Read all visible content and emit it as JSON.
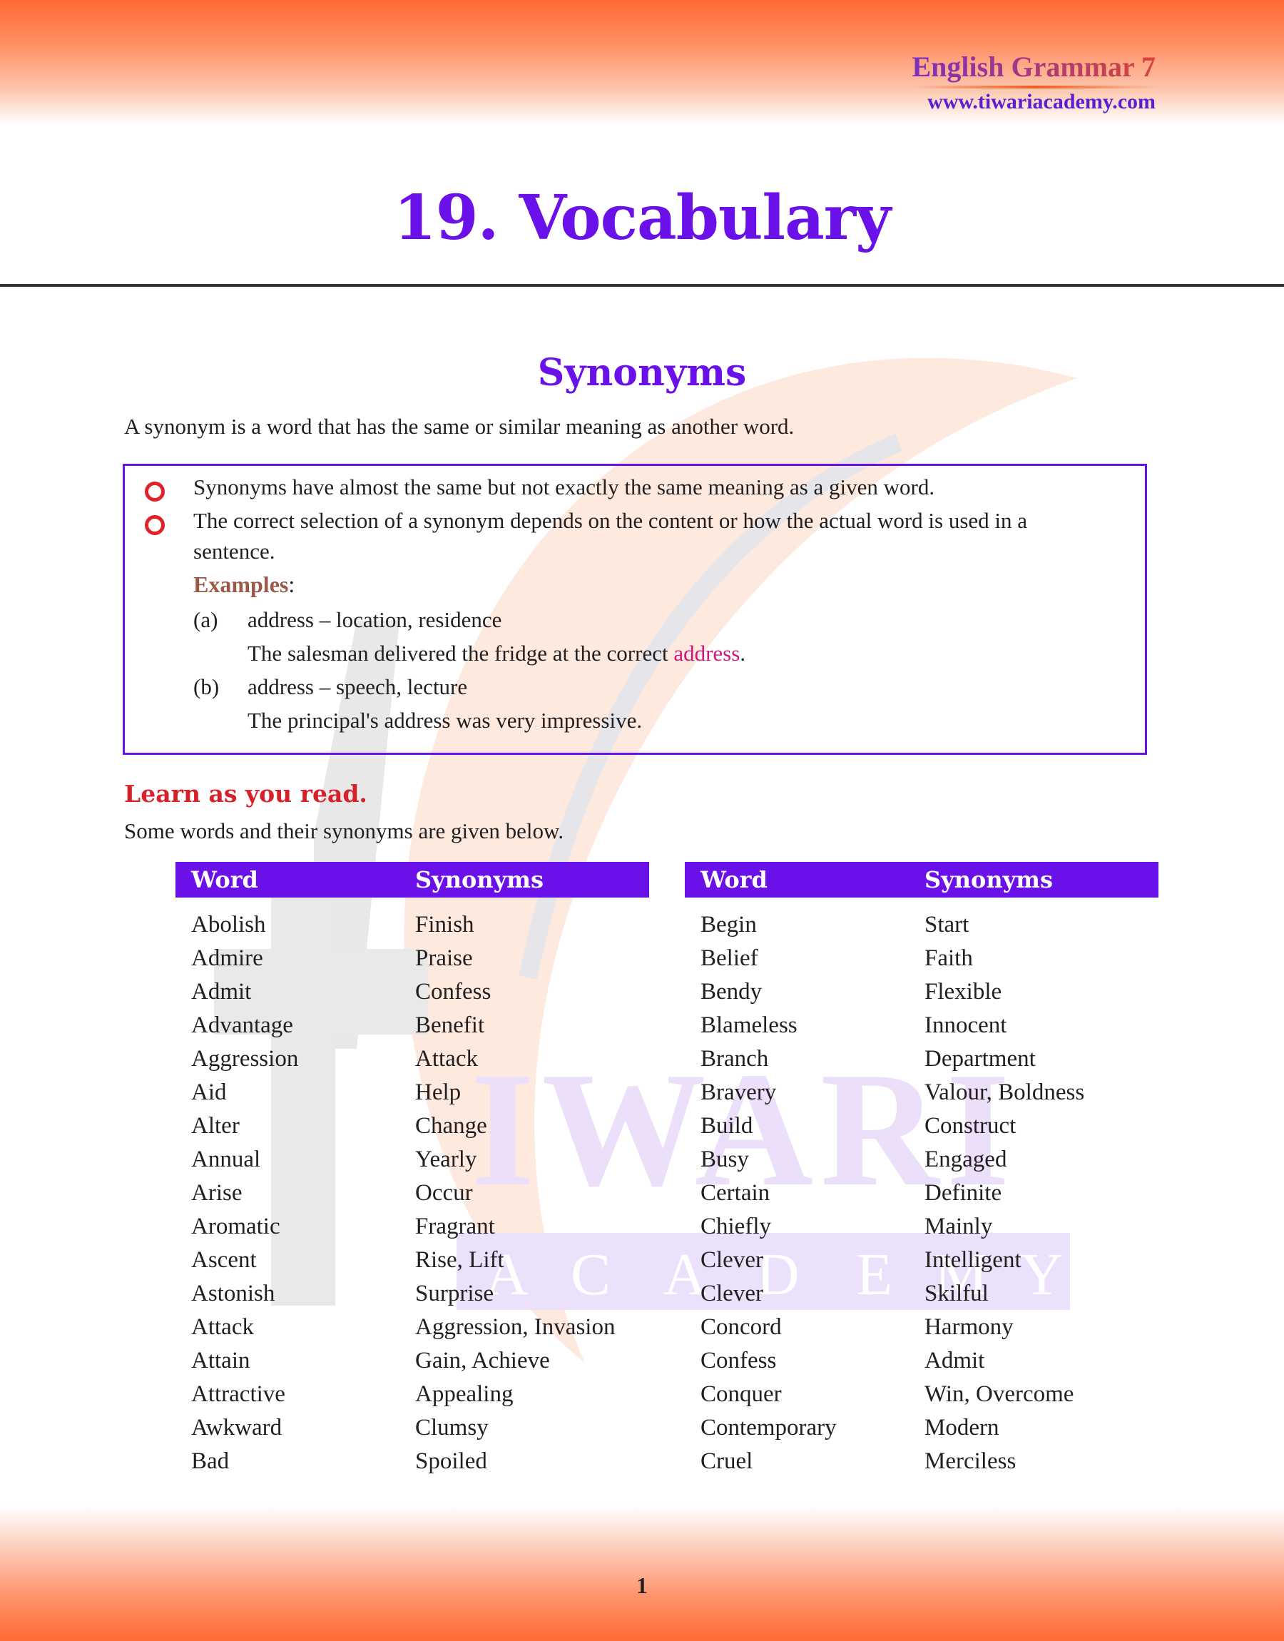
{
  "header": {
    "book_title": "English Grammar 7",
    "website": "www.tiwariacademy.com"
  },
  "watermark": {
    "text": "IWARI",
    "subtext": [
      "A",
      "C",
      "A",
      "D",
      "E",
      "M",
      "Y"
    ]
  },
  "chapter_title": "19. Vocabulary",
  "section_title": "Synonyms",
  "definition": "A synonym is a word that has the same or similar meaning as another word.",
  "notes": {
    "bullets": [
      "Synonyms have almost the same but not exactly the same meaning as a given word.",
      "The correct selection of a synonym depends on the content or how the actual word is used in a",
      "sentence."
    ],
    "examples_heading": "Examples",
    "examples_colon": ":",
    "examples": [
      {
        "label": "(a)",
        "pair": "address – location, residence",
        "sentence_before": "The salesman delivered the fridge at the correct ",
        "highlight": "address",
        "sentence_after": "."
      },
      {
        "label": "(b)",
        "pair": "address – speech, lecture",
        "sentence": "The principal's address was very impressive."
      }
    ]
  },
  "learn_heading": "Learn as you read.",
  "learn_intro": "Some words and their synonyms are given below.",
  "tables": [
    {
      "headers": [
        "Word",
        "Synonyms"
      ],
      "rows": [
        [
          "Abolish",
          "Finish"
        ],
        [
          "Admire",
          "Praise"
        ],
        [
          "Admit",
          "Confess"
        ],
        [
          "Advantage",
          "Benefit"
        ],
        [
          "Aggression",
          "Attack"
        ],
        [
          "Aid",
          "Help"
        ],
        [
          "Alter",
          "Change"
        ],
        [
          "Annual",
          "Yearly"
        ],
        [
          "Arise",
          "Occur"
        ],
        [
          "Aromatic",
          "Fragrant"
        ],
        [
          "Ascent",
          "Rise, Lift"
        ],
        [
          "Astonish",
          "Surprise"
        ],
        [
          "Attack",
          "Aggression, Invasion"
        ],
        [
          "Attain",
          "Gain, Achieve"
        ],
        [
          "Attractive",
          "Appealing"
        ],
        [
          "Awkward",
          "Clumsy"
        ],
        [
          "Bad",
          "Spoiled"
        ]
      ]
    },
    {
      "headers": [
        "Word",
        "Synonyms"
      ],
      "rows": [
        [
          "Begin",
          "Start"
        ],
        [
          "Belief",
          "Faith"
        ],
        [
          "Bendy",
          "Flexible"
        ],
        [
          "Blameless",
          "Innocent"
        ],
        [
          "Branch",
          "Department"
        ],
        [
          "Bravery",
          "Valour, Boldness"
        ],
        [
          "Build",
          "Construct"
        ],
        [
          "Busy",
          "Engaged"
        ],
        [
          "Certain",
          "Definite"
        ],
        [
          "Chiefly",
          "Mainly"
        ],
        [
          "Clever",
          "Intelligent"
        ],
        [
          "Clever",
          "Skilful"
        ],
        [
          "Concord",
          "Harmony"
        ],
        [
          "Confess",
          "Admit"
        ],
        [
          "Conquer",
          "Win, Overcome"
        ],
        [
          "Contemporary",
          "Modern"
        ],
        [
          "Cruel",
          "Merciless"
        ]
      ]
    }
  ],
  "page_number": "1",
  "colors": {
    "accent_purple": "#6a10e8",
    "bullet_red": "#e0202a",
    "band_orange": "#ff6b35",
    "highlight_pink": "#d1157a"
  }
}
